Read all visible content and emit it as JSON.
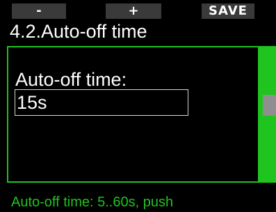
{
  "softkeys": {
    "left_label": "-",
    "center_label": "+",
    "right_label": "SAVE"
  },
  "menu": {
    "title": "4.2.Auto-off time"
  },
  "setting": {
    "label": "Auto-off time:",
    "value": "15s"
  },
  "help": {
    "text": "Auto-off time: 5..60s, push"
  },
  "colors": {
    "accent": "#1fc41f",
    "softkey_bg": "#3a3a3a",
    "background": "#000000",
    "scroll_thumb": "#8f8f8f"
  }
}
